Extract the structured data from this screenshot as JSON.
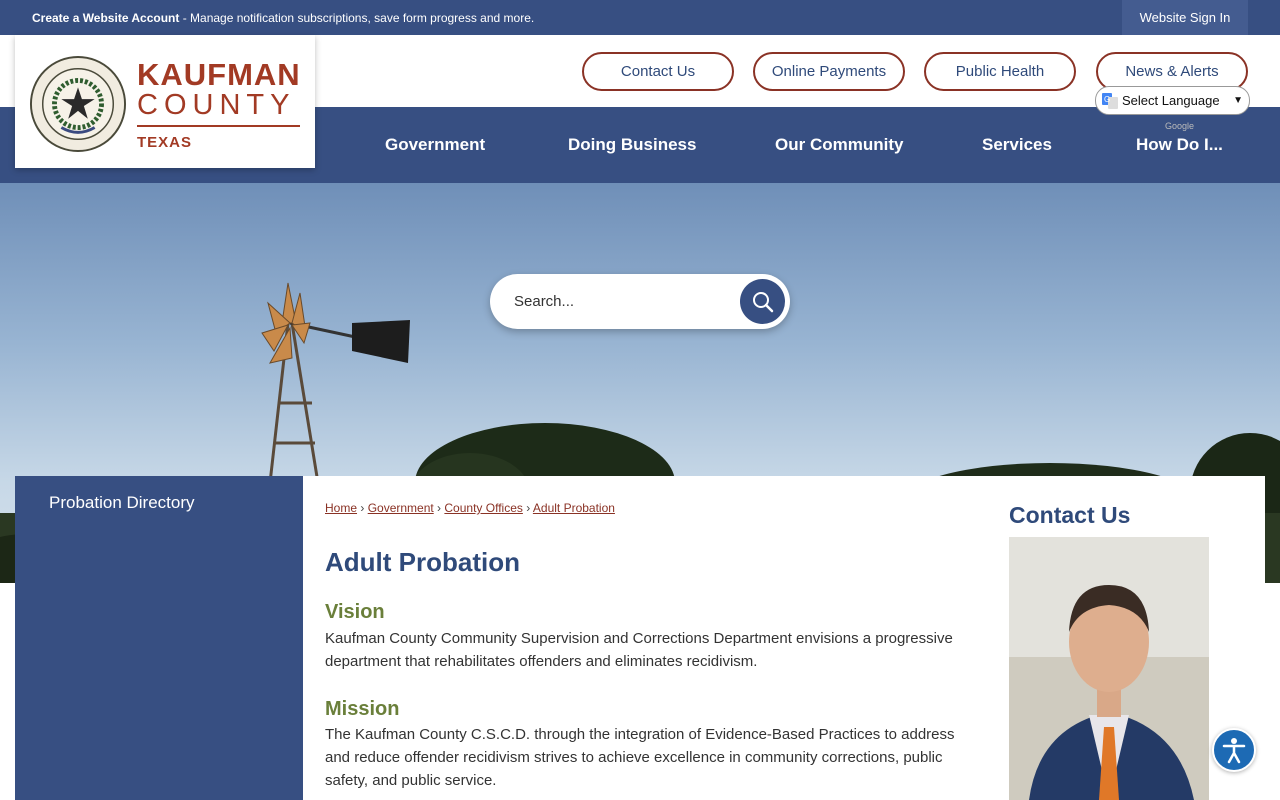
{
  "topbar": {
    "create_account": "Create a Website Account",
    "account_desc": " - Manage notification subscriptions, save form progress and more.",
    "sign_in": "Website Sign In"
  },
  "logo": {
    "title": "KAUFMAN",
    "county": "COUNTY",
    "state": "TEXAS",
    "seal_top_text": "THE STATE OF TEXAS",
    "seal_bottom_text": "KAUFMAN COUNTY"
  },
  "quick_links": [
    "Contact Us",
    "Online Payments",
    "Public Health",
    "News & Alerts"
  ],
  "translate": {
    "label": "Select Language",
    "powered_by": "Google"
  },
  "nav": [
    "Government",
    "Doing Business",
    "Our Community",
    "Services",
    "How Do I..."
  ],
  "search": {
    "placeholder": "Search..."
  },
  "sidebar": {
    "items": [
      "Probation Directory"
    ]
  },
  "breadcrumb": [
    "Home",
    "Government",
    "County Offices",
    "Adult Probation"
  ],
  "page": {
    "title": "Adult Probation",
    "vision_heading": "Vision",
    "vision_text": "Kaufman County Community Supervision and Corrections Department envisions a progressive department that rehabilitates offenders and eliminates recidivism.",
    "mission_heading": "Mission",
    "mission_text": "The Kaufman County C.S.C.D. through the integration of Evidence-Based Practices to address and reduce offender recidivism strives to achieve excellence in community corrections, public safety, and public service."
  },
  "contact": {
    "heading": "Contact Us"
  },
  "colors": {
    "navy": "#374f82",
    "brand_red": "#a23a24",
    "accent_green": "#6a7f3a"
  }
}
